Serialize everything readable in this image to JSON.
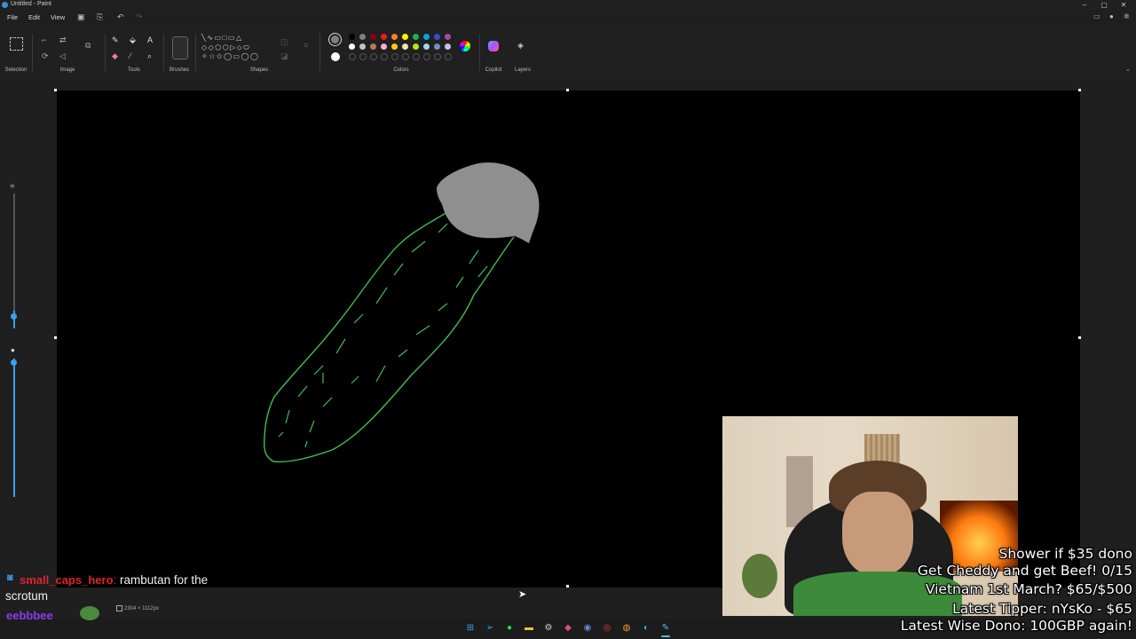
{
  "window": {
    "title": "Untitled - Paint",
    "minimize": "–",
    "maximize": "▢",
    "close": "✕"
  },
  "menu": {
    "file": "File",
    "edit": "Edit",
    "view": "View"
  },
  "ribbon": {
    "groups": {
      "selection": "Selection",
      "image": "Image",
      "tools": "Tools",
      "brushes": "Brushes",
      "shapes": "Shapes",
      "colors": "Colors",
      "copilot": "Copilot",
      "layers": "Layers"
    },
    "palette_row1": [
      "#000000",
      "#7f7f7f",
      "#880015",
      "#ed1c24",
      "#ff7f27",
      "#fff200",
      "#22b14c",
      "#00a2e8",
      "#3f48cc",
      "#a349a4"
    ],
    "palette_row2": [
      "#ffffff",
      "#c3c3c3",
      "#b97a57",
      "#ffaec9",
      "#ffc90e",
      "#efe4b0",
      "#b5e61d",
      "#99d9ea",
      "#7092be",
      "#c8bfe7"
    ],
    "color1": "#7f7f7f",
    "color2": "#ffffff"
  },
  "status": {
    "canvas_size": "2304 × 1112px"
  },
  "chat": {
    "user": "small_caps_hero",
    "message": "rambutan for the scrotum",
    "next_user": "eebbbee"
  },
  "stream_overlay": {
    "line1": "Shower if $35 dono",
    "line2": "Get Cheddy and get Beef! 0/15",
    "line3": "Vietnam 1st March? $65/$500",
    "line4": "Latest Tipper: nYsKo - $65",
    "line5": "Latest Wise Dono: 100GBP again!"
  },
  "taskbar_icons": [
    "start-icon",
    "telegram-icon",
    "spotify-icon",
    "folder-icon",
    "steam-icon",
    "app-icon",
    "discord-icon",
    "chrome-icon",
    "app2-icon",
    "edge-icon",
    "paint-icon"
  ]
}
